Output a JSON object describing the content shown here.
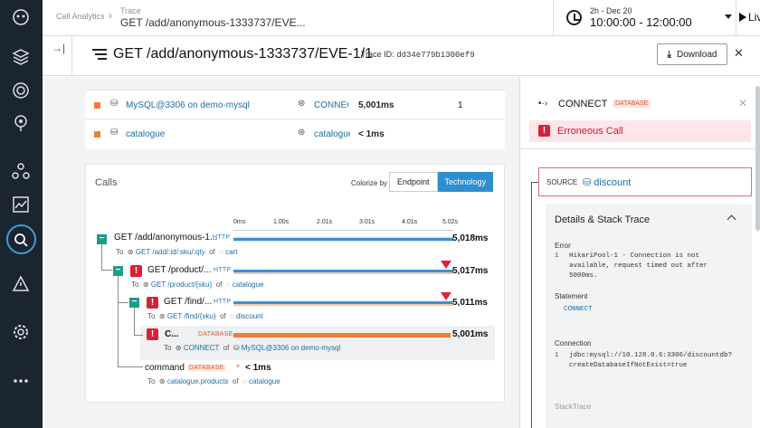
{
  "sidebar": {
    "icons": [
      "logo-icon",
      "layers-icon",
      "target-icon",
      "map-pin-icon",
      "network-icon",
      "chart-icon",
      "search-icon",
      "alert-icon",
      "gear-icon",
      "more-icon"
    ]
  },
  "topbar": {
    "app": "Call Analytics",
    "section": "Trace",
    "title": "GET /add/anonymous-1333737/EVE...",
    "time_range_small": "2h - Dec 20",
    "time_range": "10:00:00 - 12:00:00",
    "live": "Live"
  },
  "header": {
    "title": "GET /add/anonymous-1333737/EVE-1/1",
    "trace_id_label": "Trace ID:",
    "trace_id": "dd34e779b1300ef9",
    "download": "Download"
  },
  "table": {
    "rows": [
      {
        "name": "MySQL@3306 on demo-mysql",
        "op": "CONNECT",
        "dur": "5,001ms",
        "count": "1"
      },
      {
        "name": "catalogue",
        "op": "catalogue",
        "dur": "< 1ms",
        "count": ""
      }
    ]
  },
  "calls": {
    "title": "Calls",
    "colorize": "Colorize by",
    "endpoint": "Endpoint",
    "technology": "Technology",
    "axis": [
      "0ms",
      "1.00s",
      "2.01s",
      "3.01s",
      "4.01s",
      "5.02s"
    ],
    "items": [
      {
        "label": "GET /add/anonymous-1...",
        "tag": "HTTP",
        "dur": "5,018ms",
        "to": "To",
        "path": "GET /add/:id/:sku/:qty",
        "of": "of",
        "svc": "cart",
        "fraction": 1.0
      },
      {
        "label": "GET /product/...",
        "tag": "HTTP",
        "dur": "5,017ms",
        "to": "To",
        "path": "GET /product/{sku}",
        "of": "of",
        "svc": "catalogue",
        "fraction": 1.0
      },
      {
        "label": "GET /find/...",
        "tag": "HTTP",
        "dur": "5,011ms",
        "to": "To",
        "path": "GET /find/{sku}",
        "of": "of",
        "svc": "discount",
        "fraction": 1.0
      },
      {
        "label": "C...",
        "tag": "DATABASE",
        "dur": "5,001ms",
        "to": "To",
        "path": "CONNECT",
        "of": "of",
        "svc": "MySQL@3306 on demo-mysql",
        "fraction": 0.99
      },
      {
        "label": "command",
        "tag": "DATABASE",
        "dur": "< 1ms",
        "to": "To",
        "path": "catalogue.products",
        "of": "of",
        "svc": "catalogue",
        "fraction": 0
      }
    ]
  },
  "panel": {
    "op": "CONNECT",
    "badge": "DATABASE",
    "error": "Erroneous Call",
    "source_label": "SOURCE",
    "source": "discount",
    "details_title": "Details & Stack Trace",
    "error_label": "Error",
    "error_lines": [
      "HikariPool-1 - Connection is not",
      "available, request timed out after",
      "5000ms."
    ],
    "statement_label": "Statement",
    "statement": "CONNECT",
    "connection_label": "Connection",
    "connection_lines": [
      "jdbc:mysql://10.128.0.6:3306/discountdb?",
      "createDatabaseIfNotExist=true"
    ],
    "stacktrace_label": "StackTrace"
  },
  "colors": {
    "sidebar": "#1b2530",
    "accent": "#2f8fce",
    "error": "#d6213a",
    "database": "#ee7d3b",
    "http": "#3a91d8"
  }
}
